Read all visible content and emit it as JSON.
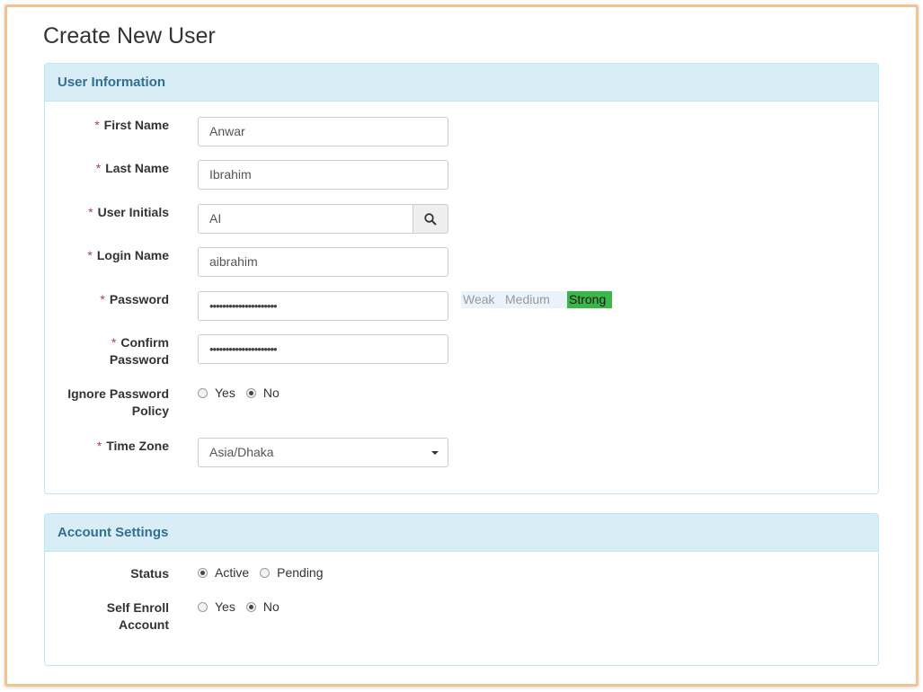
{
  "page": {
    "title": "Create New User"
  },
  "user_info": {
    "heading": "User Information",
    "required_mark": "*",
    "first_name": {
      "label": "First Name",
      "value": "Anwar"
    },
    "last_name": {
      "label": "Last Name",
      "value": "Ibrahim"
    },
    "initials": {
      "label": "User Initials",
      "value": "AI",
      "button_icon": "search-icon"
    },
    "login_name": {
      "label": "Login Name",
      "value": "aibrahim"
    },
    "password": {
      "label": "Password",
      "value": "•••••••••••••••••••••"
    },
    "strength": {
      "weak": "Weak",
      "medium": "Medium",
      "strong": "Strong",
      "selected": "Strong",
      "strong_color": "#3cb54a"
    },
    "confirm_password": {
      "label_line1": "Confirm",
      "label_line2": "Password",
      "value": "•••••••••••••••••••••"
    },
    "ignore_policy": {
      "label_line1": "Ignore Password",
      "label_line2": "Policy",
      "options": [
        "Yes",
        "No"
      ],
      "selected": "No"
    },
    "time_zone": {
      "label": "Time Zone",
      "value": "Asia/Dhaka"
    }
  },
  "account_settings": {
    "heading": "Account Settings",
    "status": {
      "label": "Status",
      "options": [
        "Active",
        "Pending"
      ],
      "selected": "Active"
    },
    "self_enroll": {
      "label_line1": "Self Enroll",
      "label_line2": "Account",
      "options": [
        "Yes",
        "No"
      ],
      "selected": "No"
    }
  },
  "colors": {
    "panel_heading_bg": "#d9edf7",
    "panel_heading_text": "#31708f",
    "frame_border": "#f5c18e",
    "required": "#a94442"
  }
}
